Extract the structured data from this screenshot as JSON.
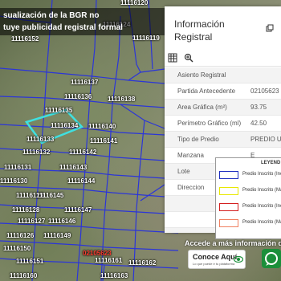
{
  "banner": {
    "line1": "sualización de la BGR no",
    "line2": "tuye publicidad registral formal"
  },
  "panel": {
    "title_line1": "Información",
    "title_line2": "Registral",
    "pin_icon": "pin-icon",
    "tools": [
      "table-icon",
      "zoom-to-icon"
    ],
    "rows": [
      {
        "key": "Asiento Registral",
        "value": ""
      },
      {
        "key": "Partida Antecedente",
        "value": "02105623"
      },
      {
        "key": "Area Gráfica (m²)",
        "value": "93.75"
      },
      {
        "key": "Perímetro Gráfico (ml)",
        "value": "42.50"
      },
      {
        "key": "Tipo de Predio",
        "value": "PREDIO UR"
      },
      {
        "key": "Manzana",
        "value": "E"
      },
      {
        "key": "Lote",
        "value": ""
      },
      {
        "key": "Direccion",
        "value": ""
      },
      {
        "key": "",
        "value": ""
      },
      {
        "key": "",
        "value": ""
      },
      {
        "key": "Unidad Catas",
        "value": ""
      }
    ]
  },
  "legend": {
    "title": "LEYEND",
    "items": [
      {
        "label": "Predio Inscrito (Inc",
        "color": "#1f2fbf"
      },
      {
        "label": "Predio Inscrito (Ma",
        "color": "#e8e800"
      },
      {
        "label": "Predio Inscrito (Inc",
        "color": "#d42020"
      },
      {
        "label": "Predio Inscrito (Ma",
        "color": "#f08060"
      }
    ]
  },
  "promo": {
    "text": "Accede a más información de",
    "button_label": "Conoce Aquí",
    "button_sub": "Lo que puede ir tu plataforma"
  },
  "map": {
    "parcel_labels": [
      {
        "text": "11116124",
        "red": false
      },
      {
        "text": "11116119",
        "red": false
      },
      {
        "text": "11116137",
        "red": false
      },
      {
        "text": "11116136",
        "red": false
      },
      {
        "text": "11116138",
        "red": false
      },
      {
        "text": "11116135",
        "red": false
      },
      {
        "text": "11116134",
        "red": false
      },
      {
        "text": "11116140",
        "red": false
      },
      {
        "text": "11116133",
        "red": false
      },
      {
        "text": "11116141",
        "red": false
      },
      {
        "text": "11116132",
        "red": false
      },
      {
        "text": "11116142",
        "red": false
      },
      {
        "text": "11116131",
        "red": false
      },
      {
        "text": "11116143",
        "red": false
      },
      {
        "text": "11116130",
        "red": false
      },
      {
        "text": "11116144",
        "red": false
      },
      {
        "text": "11116129",
        "red": false
      },
      {
        "text": "11116145",
        "red": false
      },
      {
        "text": "11116128",
        "red": false
      },
      {
        "text": "11116147",
        "red": false
      },
      {
        "text": "11116127",
        "red": false
      },
      {
        "text": "11116146",
        "red": false
      },
      {
        "text": "11116126",
        "red": false
      },
      {
        "text": "11116149",
        "red": false
      },
      {
        "text": "11116150",
        "red": false
      },
      {
        "text": "11116151",
        "red": false
      },
      {
        "text": "11116161",
        "red": false
      },
      {
        "text": "02105623",
        "red": true
      },
      {
        "text": "11116162",
        "red": false
      },
      {
        "text": "11116160",
        "red": false
      },
      {
        "text": "11116163",
        "red": false
      },
      {
        "text": "11116120",
        "red": false
      },
      {
        "text": "11116152",
        "red": false
      }
    ]
  }
}
